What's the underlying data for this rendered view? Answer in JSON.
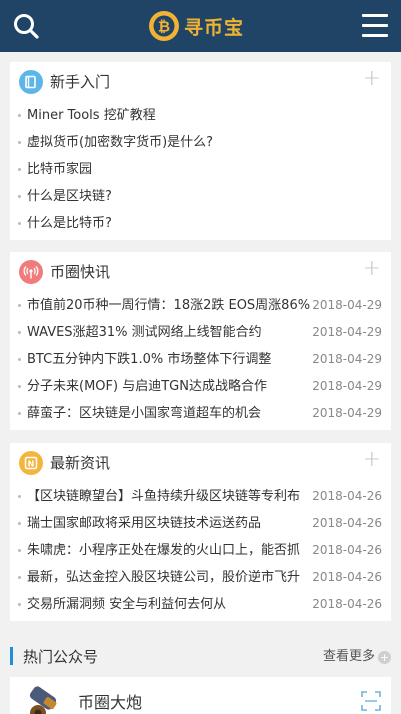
{
  "header": {
    "logo_text": "寻币宝",
    "icons": {
      "search": "search-icon",
      "menu": "hamburger-menu-icon",
      "logo": "bitcoin-coin-icon"
    },
    "bg_color": "#1f4466"
  },
  "beginner": {
    "title": "新手入门",
    "icon": "book-icon",
    "icon_color": "#5db6e8",
    "plus": "+",
    "items": [
      {
        "text": "Miner Tools 挖矿教程"
      },
      {
        "text": "虚拟货币(加密数字货币)是什么?"
      },
      {
        "text": "比特币家园"
      },
      {
        "text": "什么是区块链?"
      },
      {
        "text": "什么是比特币?"
      }
    ]
  },
  "flash": {
    "title": "币圈快讯",
    "icon": "broadcast-icon",
    "icon_color": "#f07b7b",
    "plus": "+",
    "items": [
      {
        "text": "市值前20币种一周行情：18涨2跌 EOS周涨86%",
        "date": "2018-04-29"
      },
      {
        "text": "WAVES涨超31% 测试网络上线智能合约",
        "date": "2018-04-29"
      },
      {
        "text": "BTC五分钟内下跌1.0% 市场整体下行调整",
        "date": "2018-04-29"
      },
      {
        "text": "分子未来(MOF) 与启迪TGN达成战略合作",
        "date": "2018-04-29"
      },
      {
        "text": "薛蛮子：区块链是小国家弯道超车的机会",
        "date": "2018-04-29"
      }
    ]
  },
  "news": {
    "title": "最新资讯",
    "icon": "news-icon",
    "icon_color": "#f3b63c",
    "plus": "+",
    "items": [
      {
        "text": "【区块链瞭望台】斗鱼持续升级区块链等专利布",
        "date": "2018-04-26"
      },
      {
        "text": "瑞士国家邮政将采用区块链技术运送药品",
        "date": "2018-04-26"
      },
      {
        "text": "朱啸虎：小程序正处在爆发的火山口上，能否抓",
        "date": "2018-04-26"
      },
      {
        "text": "最新，弘达金控入股区块链公司，股价逆市飞升",
        "date": "2018-04-26"
      },
      {
        "text": "交易所漏洞频 安全与利益何去何从",
        "date": "2018-04-26"
      }
    ]
  },
  "accounts": {
    "title": "热门公众号",
    "more": "查看更多",
    "more_icon": "plus-circle-icon",
    "first": {
      "name": "币圈大炮",
      "avatar": "cannon-avatar-icon",
      "qr_icon": "qr-scan-icon"
    }
  }
}
